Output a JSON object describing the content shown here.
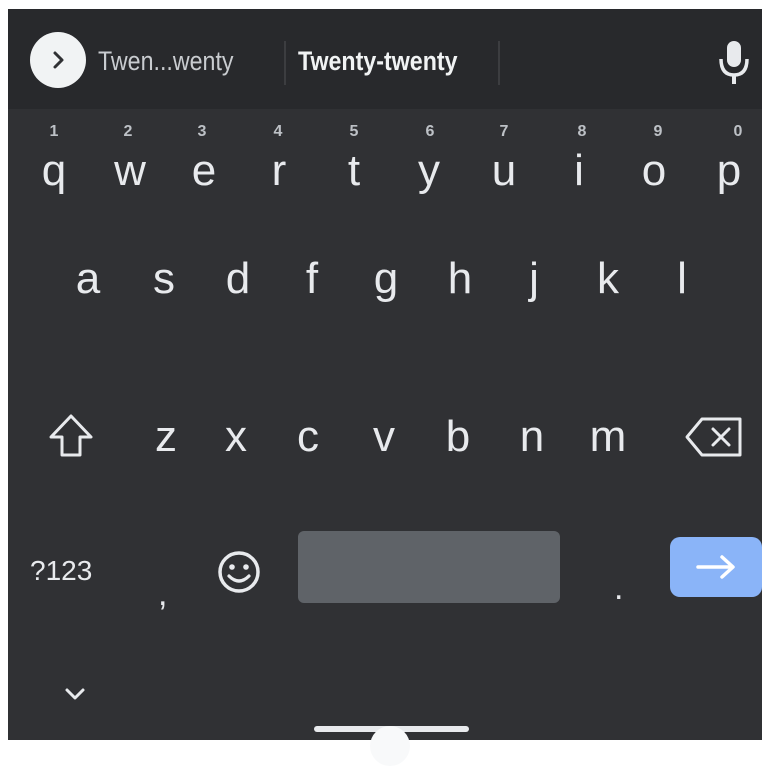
{
  "suggestions": {
    "left": "Twen...wenty",
    "middle": "Twenty-twenty",
    "right": ""
  },
  "icons": {
    "expand": "chevron-right-icon",
    "mic": "microphone-icon",
    "shift": "shift-icon",
    "backspace": "backspace-icon",
    "emoji": "emoji-icon",
    "enter": "arrow-right-icon",
    "hide": "chevron-down-icon"
  },
  "rows": {
    "row1": [
      {
        "key": "q",
        "hint": "1"
      },
      {
        "key": "w",
        "hint": "2"
      },
      {
        "key": "e",
        "hint": "3"
      },
      {
        "key": "r",
        "hint": "4"
      },
      {
        "key": "t",
        "hint": "5"
      },
      {
        "key": "y",
        "hint": "6"
      },
      {
        "key": "u",
        "hint": "7"
      },
      {
        "key": "i",
        "hint": "8"
      },
      {
        "key": "o",
        "hint": "9"
      },
      {
        "key": "p",
        "hint": "0"
      }
    ],
    "row2": [
      "a",
      "s",
      "d",
      "f",
      "g",
      "h",
      "j",
      "k",
      "l"
    ],
    "row3": [
      "z",
      "x",
      "c",
      "v",
      "b",
      "n",
      "m"
    ]
  },
  "bottom": {
    "symbols_label": "?123",
    "comma": ",",
    "period": "."
  },
  "colors": {
    "keyboard_bg": "#303134",
    "strip_bg": "#28292c",
    "key_text": "#e8eaed",
    "space_bar": "#5f6368",
    "enter_key": "#8ab4f8"
  }
}
